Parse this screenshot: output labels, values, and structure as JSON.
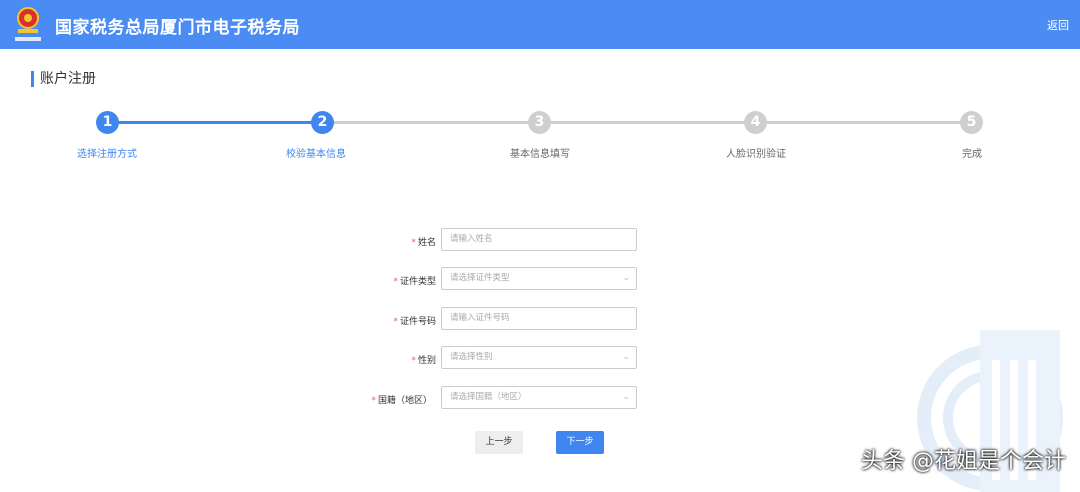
{
  "header": {
    "title": "国家税务总局厦门市电子税务局",
    "back": "返回"
  },
  "page_title": "账户注册",
  "steps": [
    {
      "num": "1",
      "label": "选择注册方式",
      "state": "done"
    },
    {
      "num": "2",
      "label": "校验基本信息",
      "state": "active"
    },
    {
      "num": "3",
      "label": "基本信息填写",
      "state": "pending"
    },
    {
      "num": "4",
      "label": "人脸识别验证",
      "state": "pending"
    },
    {
      "num": "5",
      "label": "完成",
      "state": "pending"
    }
  ],
  "form": [
    {
      "label": "姓名",
      "placeholder": "请输入姓名",
      "type": "input"
    },
    {
      "label": "证件类型",
      "placeholder": "请选择证件类型",
      "type": "select"
    },
    {
      "label": "证件号码",
      "placeholder": "请输入证件号码",
      "type": "input"
    },
    {
      "label": "性别",
      "placeholder": "请选择性别",
      "type": "select"
    },
    {
      "label": "国籍（地区）",
      "placeholder": "请选择国籍（地区）",
      "type": "select"
    }
  ],
  "required_mark": "*",
  "buttons": {
    "prev": "上一步",
    "next": "下一步"
  },
  "watermark": "头条 @花姐是个会计",
  "colors": {
    "primary": "#4a8cf3",
    "pending": "#c8c8c8"
  }
}
